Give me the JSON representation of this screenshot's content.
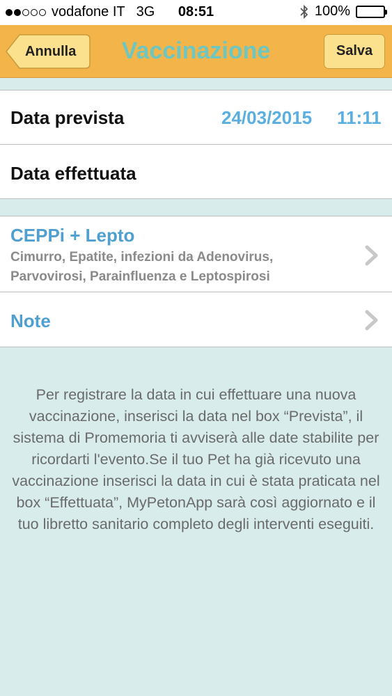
{
  "status_bar": {
    "carrier": "vodafone IT",
    "network": "3G",
    "time": "08:51",
    "battery": "100%",
    "signal_bars": 2
  },
  "nav": {
    "title": "Vaccinazione",
    "cancel_label": "Annulla",
    "save_label": "Salva"
  },
  "form": {
    "planned": {
      "label": "Data prevista",
      "date": "24/03/2015",
      "time": "11:11"
    },
    "done": {
      "label": "Data effettuata"
    }
  },
  "vaccine": {
    "title": "CEPPi + Lepto",
    "description_line1": "Cimurro, Epatite, infezioni da Adenovirus,",
    "description_line2": "Parvovirosi, Parainfluenza e Leptospirosi"
  },
  "note": {
    "label": "Note"
  },
  "info_text": "Per registrare la data in cui effettuare una nuova vaccinazione, inserisci la data nel box “Prevista”, il sistema di Promemoria ti avviserà alle date stabilite per ricordarti l'evento.Se il tuo Pet ha già ricevuto una vaccinazione inserisci la data in cui è stata praticata nel box “Effettuata”, MyPetonApp sarà così aggiornato e il tuo libretto sanitario completo degli interventi eseguiti.",
  "colors": {
    "nav_background": "#f3b44a",
    "nav_title": "#6ec6c0",
    "accent_blue": "#4f9fd0",
    "page_background": "#d8ecec"
  },
  "icons": [
    "bluetooth-icon",
    "battery-icon",
    "chevron-right-icon",
    "back-arrow-button"
  ]
}
